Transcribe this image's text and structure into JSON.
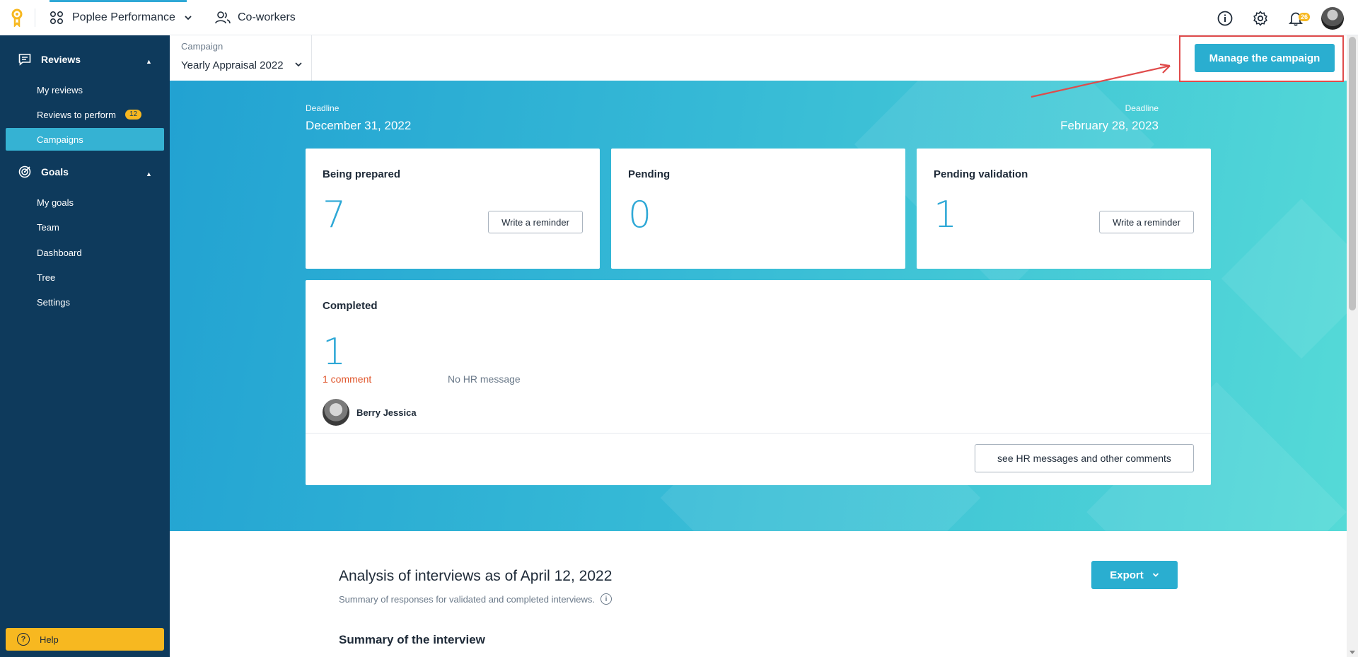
{
  "topbar": {
    "app_name": "Poplee Performance",
    "coworkers_label": "Co-workers",
    "notifications_count": "26"
  },
  "sidebar": {
    "reviews_section": "Reviews",
    "reviews_items": [
      {
        "label": "My reviews"
      },
      {
        "label": "Reviews to perform",
        "badge": "12"
      },
      {
        "label": "Campaigns",
        "active": true
      }
    ],
    "goals_section": "Goals",
    "goals_items": [
      {
        "label": "My goals"
      },
      {
        "label": "Team"
      },
      {
        "label": "Dashboard"
      },
      {
        "label": "Tree"
      },
      {
        "label": "Settings"
      }
    ],
    "help_label": "Help"
  },
  "campaign": {
    "label": "Campaign",
    "selected": "Yearly Appraisal 2022"
  },
  "manage_button": "Manage the campaign",
  "deadlines": {
    "left_label": "Deadline",
    "left_date": "December 31, 2022",
    "right_label": "Deadline",
    "right_date": "February 28, 2023"
  },
  "cards": {
    "being_prepared": {
      "title": "Being prepared",
      "count": "7",
      "button": "Write a reminder"
    },
    "pending": {
      "title": "Pending",
      "count": "0"
    },
    "pending_validation": {
      "title": "Pending validation",
      "count": "1",
      "button": "Write a reminder"
    },
    "completed": {
      "title": "Completed",
      "count": "1",
      "comment_link": "1 comment",
      "hr_message": "No HR message",
      "person": "Berry Jessica",
      "button": "see HR messages and other comments"
    }
  },
  "analysis": {
    "title": "Analysis of interviews as of April 12, 2022",
    "subtitle": "Summary of responses for validated and completed interviews.",
    "export_label": "Export",
    "summary_title": "Summary of the interview"
  },
  "colors": {
    "sidebar_bg": "#0e3a5c",
    "accent": "#2aaed0",
    "badge": "#f7b820",
    "annotation": "#e04b4b",
    "comment_link": "#e0562c"
  },
  "icons": [
    "logo-icon",
    "apps-grid-icon",
    "chevron-down-icon",
    "coworkers-icon",
    "info-icon",
    "gear-icon",
    "bell-icon",
    "chat-icon",
    "target-icon",
    "help-icon"
  ]
}
